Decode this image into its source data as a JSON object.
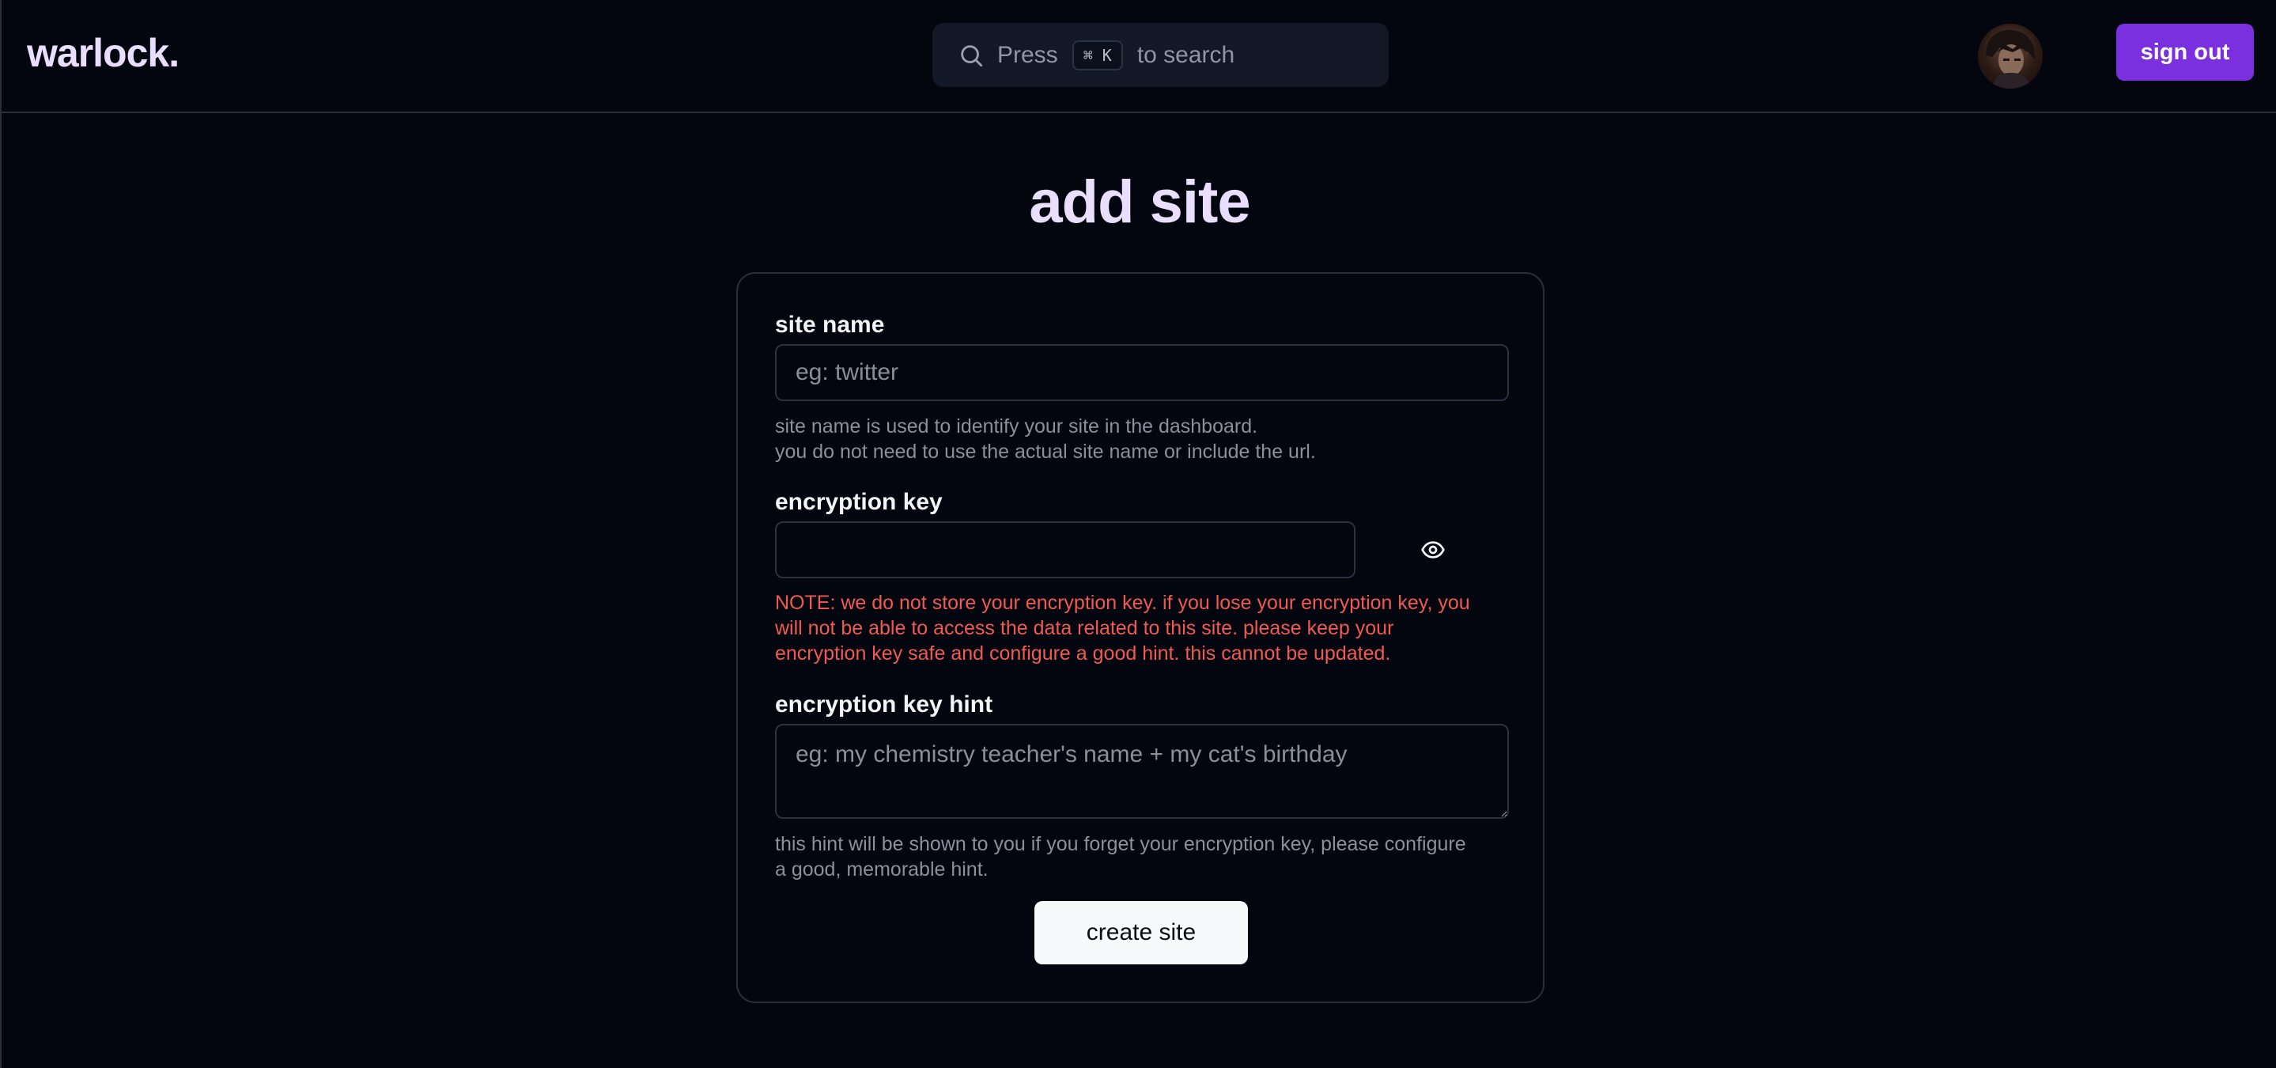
{
  "header": {
    "logo": "warlock.",
    "search": {
      "prefix": "Press",
      "shortcut": "⌘ K",
      "suffix": "to search"
    },
    "sign_out_label": "sign out"
  },
  "main": {
    "title": "add site",
    "form": {
      "site_name": {
        "label": "site name",
        "placeholder": "eg: twitter",
        "help_line1": "site name is used to identify your site in the dashboard.",
        "help_line2": "you do not need to use the actual site name or include the url."
      },
      "encryption_key": {
        "label": "encryption key",
        "note_line1": "NOTE: we do not store your encryption key. if you lose your encryption key, you",
        "note_line2": "will not be able to access the data related to this site. please keep your",
        "note_line3": "encryption key safe and configure a good hint. this cannot be updated."
      },
      "encryption_key_hint": {
        "label": "encryption key hint",
        "placeholder": "eg: my chemistry teacher's name + my cat's birthday",
        "help_line1": "this hint will be shown to you if you forget your encryption key, please configure",
        "help_line2": "a good, memorable hint."
      },
      "submit_label": "create site"
    }
  },
  "colors": {
    "background": "#03050f",
    "accent": "#7b30e0",
    "heading": "#e9defc",
    "warning": "#f15a52"
  },
  "icons": [
    "search-icon",
    "eye-icon"
  ]
}
